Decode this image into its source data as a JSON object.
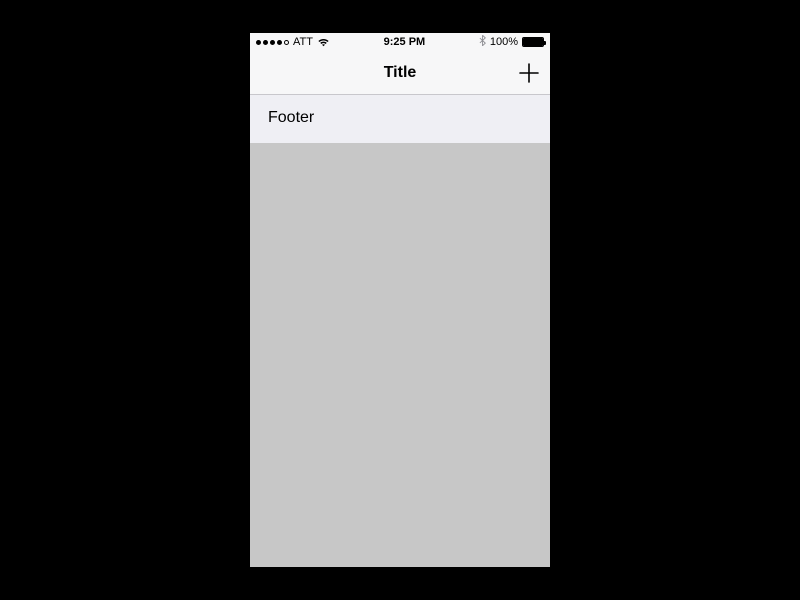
{
  "statusbar": {
    "carrier": "ATT",
    "time": "9:25 PM",
    "battery_pct": "100%",
    "battery_fill_pct": 100,
    "signal_filled_dots": 4,
    "signal_total_dots": 5
  },
  "navbar": {
    "title": "Title"
  },
  "section": {
    "footer": "Footer"
  },
  "icons": {
    "add": "plus-icon",
    "wifi": "wifi-icon",
    "bluetooth": "bluetooth-icon",
    "battery": "battery-icon",
    "signal": "signal-dots"
  }
}
